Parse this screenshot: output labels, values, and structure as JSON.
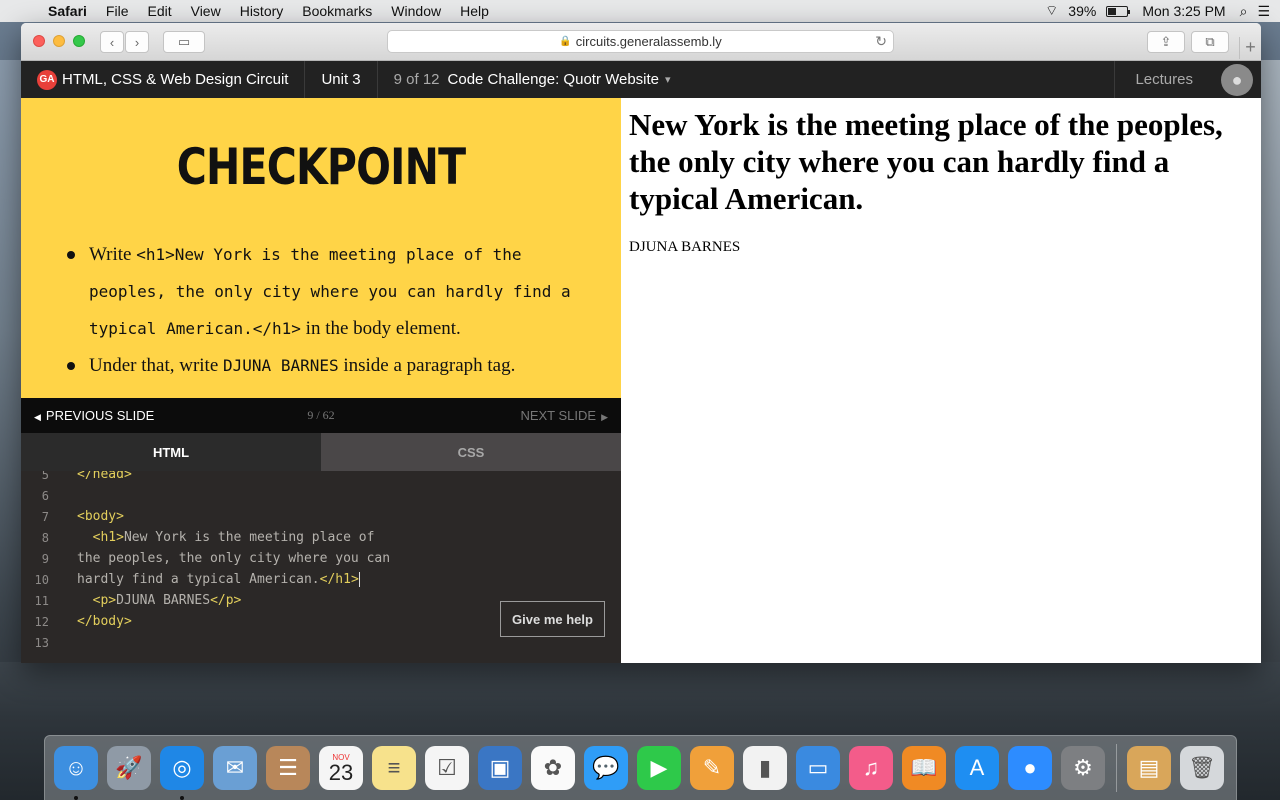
{
  "menubar": {
    "app": "Safari",
    "items": [
      "File",
      "Edit",
      "View",
      "History",
      "Bookmarks",
      "Window",
      "Help"
    ],
    "battery": "39%",
    "clock": "Mon 3:25 PM"
  },
  "browser": {
    "url": "circuits.generalassemb.ly"
  },
  "ganav": {
    "logo": "GA",
    "course": "HTML, CSS & Web Design Circuit",
    "unit": "Unit 3",
    "counter": "9 of 12",
    "lesson": "Code Challenge: Quotr Website",
    "lectures": "Lectures"
  },
  "slide": {
    "title": "CHECKPOINT",
    "bullet1_pre": "Write ",
    "bullet1_code": "<h1>New York is the meeting place of the peoples, the only city where you can hardly find a typical American.</h1>",
    "bullet1_post": " in the body element.",
    "bullet2_pre": "Under that, write ",
    "bullet2_code": "DJUNA BARNES",
    "bullet2_post": " inside a paragraph tag."
  },
  "slidenav": {
    "prev": "PREVIOUS SLIDE",
    "page": "9 / 62",
    "next": "NEXT SLIDE"
  },
  "editor": {
    "tabs": [
      "HTML",
      "CSS"
    ],
    "lines": [
      {
        "n": "5",
        "tag1": "</head>",
        "text": "",
        "tag2": ""
      },
      {
        "n": "6",
        "tag1": "",
        "text": "",
        "tag2": ""
      },
      {
        "n": "7",
        "tag1": "<body>",
        "text": "",
        "tag2": ""
      },
      {
        "n": "8",
        "tag1": "  <h1>",
        "text": "New York is the meeting place of",
        "tag2": ""
      },
      {
        "n": "9",
        "tag1": "",
        "text": "the peoples, the only city where you can",
        "tag2": ""
      },
      {
        "n": "10",
        "tag1": "",
        "text": "hardly find a typical American.",
        "tag2": "</h1>"
      },
      {
        "n": "11",
        "tag1": "  <p>",
        "text": "DJUNA BARNES",
        "tag2": "</p>"
      },
      {
        "n": "12",
        "tag1": "</body>",
        "text": "",
        "tag2": ""
      },
      {
        "n": "13",
        "tag1": "",
        "text": "",
        "tag2": ""
      }
    ],
    "help_button": "Give me help"
  },
  "preview": {
    "heading": "New York is the meeting place of the peoples, the only city where you can hardly find a typical American.",
    "paragraph": "DJUNA BARNES"
  },
  "dock": {
    "calendar_month": "NOV",
    "calendar_day": "23",
    "apps": [
      {
        "name": "finder-icon",
        "color": "#3d8fe0",
        "glyph": "☺"
      },
      {
        "name": "launchpad-icon",
        "color": "#8f9aa6",
        "glyph": "🚀"
      },
      {
        "name": "safari-icon",
        "color": "#1f87e6",
        "glyph": "◎"
      },
      {
        "name": "mail-icon",
        "color": "#6a9fd4",
        "glyph": "✉"
      },
      {
        "name": "contacts-icon",
        "color": "#b8875a",
        "glyph": "☰"
      },
      {
        "name": "calendar-icon",
        "color": "#f5f5f5",
        "glyph": ""
      },
      {
        "name": "notes-icon",
        "color": "#f7e28c",
        "glyph": "≡"
      },
      {
        "name": "reminders-icon",
        "color": "#f5f5f5",
        "glyph": "☑"
      },
      {
        "name": "photo-booth-icon",
        "color": "#3a76c4",
        "glyph": "▣"
      },
      {
        "name": "photos-icon",
        "color": "#fafafa",
        "glyph": "✿"
      },
      {
        "name": "messages-icon",
        "color": "#2f9df7",
        "glyph": "💬"
      },
      {
        "name": "facetime-icon",
        "color": "#2ec94a",
        "glyph": "▶"
      },
      {
        "name": "pages-icon",
        "color": "#f0a03a",
        "glyph": "✎"
      },
      {
        "name": "numbers-icon",
        "color": "#f2f2f2",
        "glyph": "▮"
      },
      {
        "name": "keynote-icon",
        "color": "#3a8ae0",
        "glyph": "▭"
      },
      {
        "name": "itunes-icon",
        "color": "#f35c8a",
        "glyph": "♫"
      },
      {
        "name": "ibooks-icon",
        "color": "#f08a24",
        "glyph": "📖"
      },
      {
        "name": "app-store-icon",
        "color": "#1e8ef2",
        "glyph": "A"
      },
      {
        "name": "zoom-icon",
        "color": "#2d8cff",
        "glyph": "●"
      },
      {
        "name": "system-preferences-icon",
        "color": "#7d7f82",
        "glyph": "⚙"
      }
    ],
    "extras": [
      {
        "name": "archive-utility-icon",
        "color": "#d9a65a",
        "glyph": "▤"
      },
      {
        "name": "trash-icon",
        "color": "#d5d8db",
        "glyph": "🗑"
      }
    ]
  }
}
